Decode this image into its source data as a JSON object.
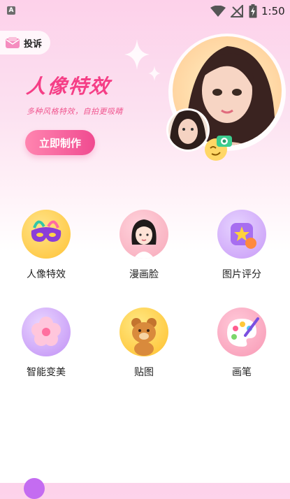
{
  "status_bar": {
    "app_badge": "A",
    "time": "1:50"
  },
  "complain": {
    "label": "投诉"
  },
  "hero": {
    "title": "人像特效",
    "subtitle": "多种风格特效，自拍更吸睛",
    "button_label": "立即制作"
  },
  "features": [
    {
      "label": "人像特效",
      "icon": "mask-icon"
    },
    {
      "label": "漫画脸",
      "icon": "cartoon-face-icon"
    },
    {
      "label": "图片评分",
      "icon": "star-rating-icon"
    },
    {
      "label": "智能变美",
      "icon": "flower-icon"
    },
    {
      "label": "贴图",
      "icon": "bear-sticker-icon"
    },
    {
      "label": "画笔",
      "icon": "palette-icon"
    }
  ],
  "colors": {
    "accent": "#f04b90",
    "title": "#f53e86"
  }
}
